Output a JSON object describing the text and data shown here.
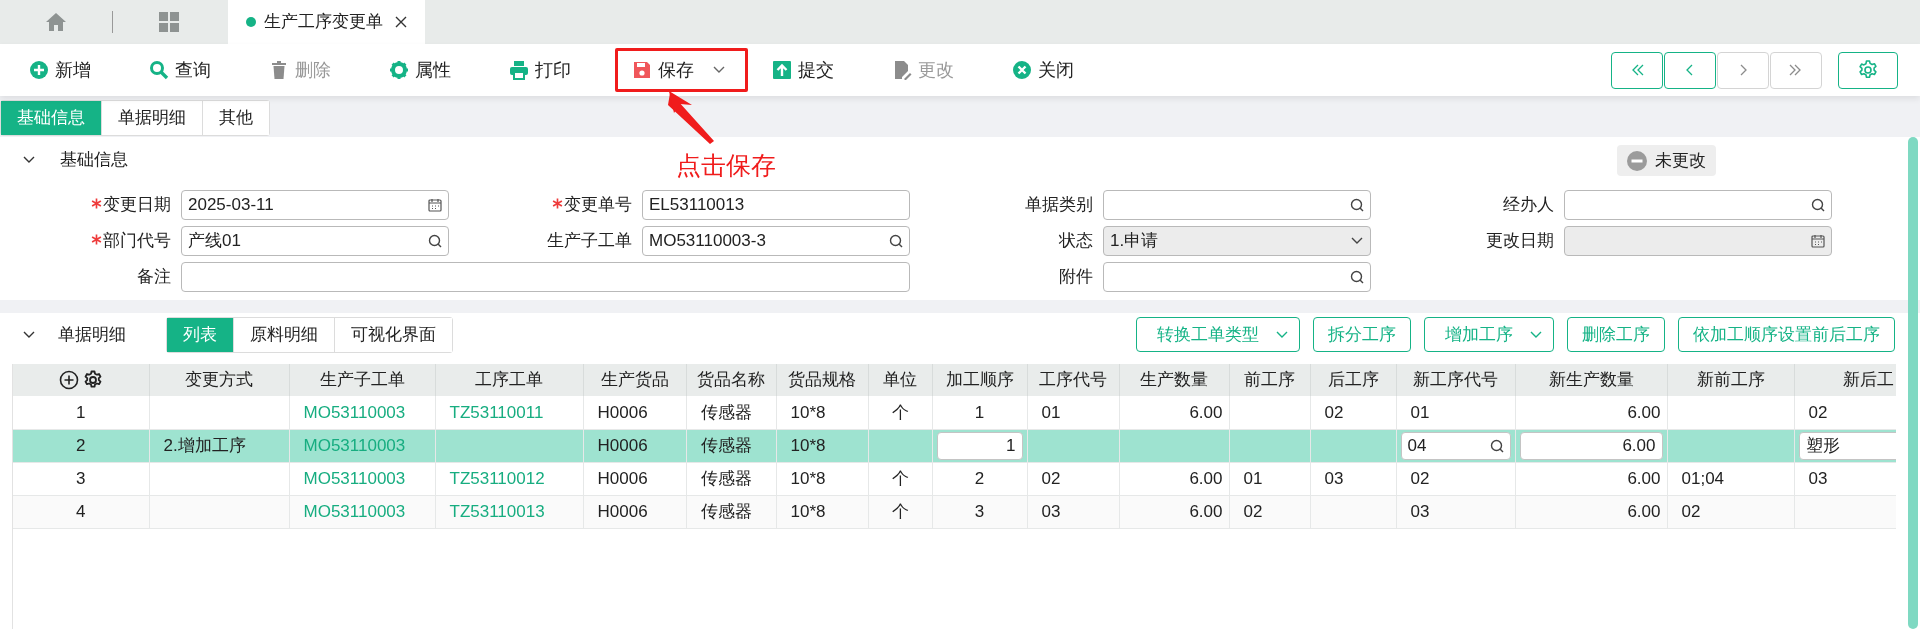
{
  "tabs": [
    {
      "kind": "home",
      "selected": false
    },
    {
      "kind": "apps",
      "selected": false
    },
    {
      "kind": "page",
      "label": "生产工序变更单",
      "selected": true
    }
  ],
  "toolbar": {
    "buttons": [
      {
        "label": "新增",
        "kind": "add",
        "disabled": false
      },
      {
        "label": "查询",
        "kind": "search",
        "disabled": false
      },
      {
        "label": "删除",
        "kind": "delete",
        "disabled": true
      },
      {
        "label": "属性",
        "kind": "gear",
        "disabled": false
      },
      {
        "label": "打印",
        "kind": "print",
        "disabled": false
      },
      {
        "label": "保存",
        "kind": "save",
        "disabled": false,
        "dropdown": true,
        "highlighted": true
      },
      {
        "label": "提交",
        "kind": "submit",
        "disabled": false
      },
      {
        "label": "更改",
        "kind": "edit",
        "disabled": true
      },
      {
        "label": "关闭",
        "kind": "close",
        "disabled": false
      }
    ],
    "nav_buttons": [
      {
        "kind": "first",
        "disabled": false
      },
      {
        "kind": "prev",
        "disabled": false
      },
      {
        "kind": "next",
        "disabled": true
      },
      {
        "kind": "last",
        "disabled": true
      }
    ]
  },
  "annotation": {
    "text": "点击保存"
  },
  "form_tabs": [
    {
      "label": "基础信息",
      "selected": true
    },
    {
      "label": "单据明细",
      "selected": false
    },
    {
      "label": "其他",
      "selected": false
    }
  ],
  "basic_info": {
    "title": "基础信息",
    "status": "未更改",
    "fields": [
      {
        "label": "变更日期",
        "required": true,
        "kind": "date",
        "value": "2025-03-11",
        "disabled": false
      },
      {
        "label": "变更单号",
        "required": true,
        "kind": "text",
        "value": "EL53110013",
        "disabled": false
      },
      {
        "label": "单据类别",
        "required": false,
        "kind": "lookup",
        "disabled": false
      },
      {
        "label": "经办人",
        "required": false,
        "kind": "lookup",
        "disabled": false
      },
      {
        "label": "部门代号",
        "required": true,
        "kind": "lookup",
        "value": "产线01",
        "disabled": false
      },
      {
        "label": "生产子工单",
        "required": false,
        "kind": "lookup",
        "value": "MO53110003-3",
        "disabled": false
      },
      {
        "label": "状态",
        "required": false,
        "kind": "select",
        "value": "1.申请",
        "disabled": true
      },
      {
        "label": "更改日期",
        "required": false,
        "kind": "date",
        "disabled": true
      },
      {
        "label": "备注",
        "required": false,
        "kind": "text",
        "disabled": false,
        "wide": true
      },
      {
        "label": "附件",
        "required": false,
        "kind": "lookup",
        "disabled": false
      }
    ]
  },
  "details": {
    "title": "单据明细",
    "view_tabs": [
      {
        "label": "列表",
        "selected": true
      },
      {
        "label": "原料明细",
        "selected": false
      },
      {
        "label": "可视化界面",
        "selected": false
      }
    ],
    "actions": [
      {
        "label": "转换工单类型",
        "dropdown": true
      },
      {
        "label": "拆分工序",
        "dropdown": false
      },
      {
        "label": "增加工序",
        "dropdown": true
      },
      {
        "label": "删除工序",
        "dropdown": false
      },
      {
        "label": "依加工顺序设置前后工序",
        "dropdown": false
      }
    ],
    "table": {
      "columns": [
        "",
        "变更方式",
        "生产子工单",
        "工序工单",
        "生产货品",
        "货品名称",
        "货品规格",
        "单位",
        "加工顺序",
        "工序代号",
        "生产数量",
        "前工序",
        "后工序",
        "新工序代号",
        "新生产数量",
        "新前工序",
        "新后工"
      ],
      "rows": [
        {
          "selected": false,
          "cells": [
            {
              "kind": "text",
              "text": "1"
            },
            {
              "kind": "empty"
            },
            {
              "kind": "link",
              "text": "MO53110003"
            },
            {
              "kind": "link",
              "text": "TZ53110011"
            },
            {
              "kind": "text",
              "text": "H0006"
            },
            {
              "kind": "text",
              "text": "传感器"
            },
            {
              "kind": "text",
              "text": "10*8"
            },
            {
              "kind": "text",
              "text": "个"
            },
            {
              "kind": "text",
              "text": "1"
            },
            {
              "kind": "text",
              "text": "01"
            },
            {
              "kind": "text",
              "text": "6.00"
            },
            {
              "kind": "empty"
            },
            {
              "kind": "text",
              "text": "02"
            },
            {
              "kind": "text",
              "text": "01"
            },
            {
              "kind": "text",
              "text": "6.00"
            },
            {
              "kind": "empty"
            },
            {
              "kind": "text",
              "text": "02"
            }
          ]
        },
        {
          "selected": true,
          "cells": [
            {
              "kind": "text",
              "text": "2"
            },
            {
              "kind": "text",
              "text": "2.增加工序"
            },
            {
              "kind": "link",
              "text": "MO53110003"
            },
            {
              "kind": "empty"
            },
            {
              "kind": "text",
              "text": "H0006"
            },
            {
              "kind": "text",
              "text": "传感器"
            },
            {
              "kind": "text",
              "text": "10*8"
            },
            {
              "kind": "empty"
            },
            {
              "kind": "input",
              "text": "1"
            },
            {
              "kind": "empty"
            },
            {
              "kind": "empty"
            },
            {
              "kind": "empty"
            },
            {
              "kind": "empty"
            },
            {
              "kind": "lookup",
              "text": "04"
            },
            {
              "kind": "input",
              "text": "6.00"
            },
            {
              "kind": "empty"
            },
            {
              "kind": "input",
              "text": "塑形"
            }
          ]
        },
        {
          "selected": false,
          "cells": [
            {
              "kind": "text",
              "text": "3"
            },
            {
              "kind": "empty"
            },
            {
              "kind": "link",
              "text": "MO53110003"
            },
            {
              "kind": "link",
              "text": "TZ53110012"
            },
            {
              "kind": "text",
              "text": "H0006"
            },
            {
              "kind": "text",
              "text": "传感器"
            },
            {
              "kind": "text",
              "text": "10*8"
            },
            {
              "kind": "text",
              "text": "个"
            },
            {
              "kind": "text",
              "text": "2"
            },
            {
              "kind": "text",
              "text": "02"
            },
            {
              "kind": "text",
              "text": "6.00"
            },
            {
              "kind": "text",
              "text": "01"
            },
            {
              "kind": "text",
              "text": "03"
            },
            {
              "kind": "text",
              "text": "02"
            },
            {
              "kind": "text",
              "text": "6.00"
            },
            {
              "kind": "text",
              "text": "01;04"
            },
            {
              "kind": "text",
              "text": "03"
            }
          ]
        },
        {
          "selected": false,
          "cells": [
            {
              "kind": "text",
              "text": "4"
            },
            {
              "kind": "empty"
            },
            {
              "kind": "link",
              "text": "MO53110003"
            },
            {
              "kind": "link",
              "text": "TZ53110013"
            },
            {
              "kind": "text",
              "text": "H0006"
            },
            {
              "kind": "text",
              "text": "传感器"
            },
            {
              "kind": "text",
              "text": "10*8"
            },
            {
              "kind": "text",
              "text": "个"
            },
            {
              "kind": "text",
              "text": "3"
            },
            {
              "kind": "text",
              "text": "03"
            },
            {
              "kind": "text",
              "text": "6.00"
            },
            {
              "kind": "text",
              "text": "02"
            },
            {
              "kind": "empty"
            },
            {
              "kind": "text",
              "text": "03"
            },
            {
              "kind": "text",
              "text": "6.00"
            },
            {
              "kind": "text",
              "text": "02"
            },
            {
              "kind": "empty"
            }
          ]
        }
      ]
    }
  }
}
